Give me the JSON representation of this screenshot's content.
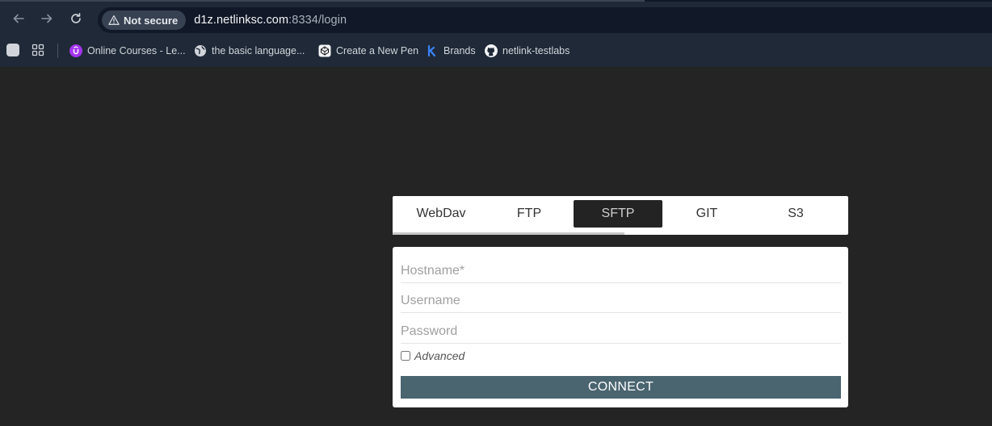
{
  "browser": {
    "security_label": "Not secure",
    "url_host": "d1z.netlinksc.com",
    "url_rest": ":8334/login",
    "bookmarks": [
      {
        "label": "Online Courses - Le...",
        "icon": "udemy-icon"
      },
      {
        "label": "the basic language...",
        "icon": "globe-icon"
      },
      {
        "label": "Create a New Pen",
        "icon": "codepen-icon"
      },
      {
        "label": "Brands",
        "icon": "k-logo-icon"
      },
      {
        "label": "netlink-testlabs",
        "icon": "github-icon"
      }
    ]
  },
  "tabs": [
    {
      "label": "WebDav",
      "active": false
    },
    {
      "label": "FTP",
      "active": false
    },
    {
      "label": "SFTP",
      "active": true
    },
    {
      "label": "GIT",
      "active": false
    },
    {
      "label": "S3",
      "active": false
    }
  ],
  "form": {
    "hostname_placeholder": "Hostname*",
    "username_placeholder": "Username",
    "password_placeholder": "Password",
    "advanced_label": "Advanced",
    "advanced_checked": false,
    "connect_label": "CONNECT"
  },
  "colors": {
    "page_bg": "#242424",
    "chrome_bg": "#1f2937",
    "active_tab_bg": "#232323",
    "connect_button_bg": "#4a6470"
  }
}
